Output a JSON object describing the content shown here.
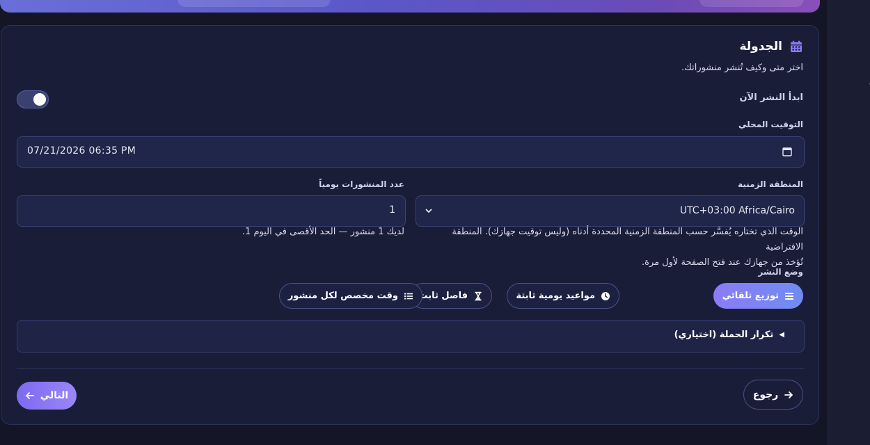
{
  "side_panel": {
    "partial_text": "ت"
  },
  "schedule": {
    "title": "الجدولة",
    "subtitle": "اختر متى وكيف تُنشر منشوراتك.",
    "start_now_label": "ابدأ النشر الآن",
    "start_now_enabled": true,
    "local_time_label": "التوقيت المحلي",
    "local_time_value": "07/21/2026  06:35 PM",
    "timezone_label": "المنطقة الزمنية",
    "timezone_value": "UTC+03:00 Africa/Cairo",
    "timezone_help_line1": "الوقت الذي تختاره يُفسَّر حسب المنطقة الزمنية المحددة أدناه (وليس توقيت جهازك). المنطقة الافتراضية",
    "timezone_help_line2": "تُؤخذ من جهازك عند فتح الصفحة لأول مرة.",
    "posts_per_day_label": "عدد المنشورات يومياً",
    "posts_per_day_value": "1",
    "posts_per_day_help": "لديك 1 منشور — الحد الأقصى في اليوم 1.",
    "mode_label": "وضع النشر",
    "modes": [
      {
        "label": "توزيع تلقائي",
        "icon": "lines-icon",
        "active": true
      },
      {
        "label": "مواعيد يومية ثابتة",
        "icon": "clock-icon",
        "active": false
      },
      {
        "label": "فاصل ثابت",
        "icon": "hourglass-icon",
        "active": false
      },
      {
        "label": "وقت مخصص لكل منشور",
        "icon": "list-icon",
        "active": false
      }
    ],
    "repeat_label": "تكرار الحملة (اختياري)",
    "back_label": "رجوع",
    "next_label": "التالي"
  }
}
